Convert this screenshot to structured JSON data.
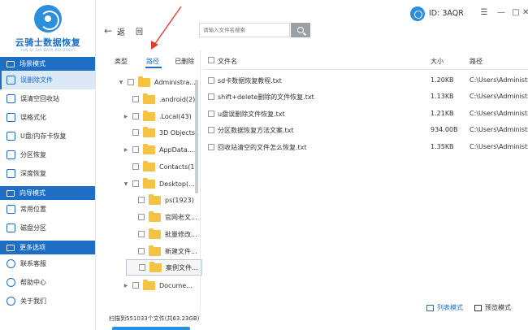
{
  "app": {
    "name": "云骑士数据恢复",
    "subtitle": "YUN QI SHI DATA RECOVERY"
  },
  "account": {
    "id_label": "ID: 3AQR"
  },
  "colors": {
    "accent": "#1e6fc4",
    "folder": "#f5c343",
    "annotation_arrow": "#e53935"
  },
  "sidebar": {
    "sections": [
      {
        "title": "场景模式",
        "items": [
          {
            "label": "误删除文件",
            "icon": "trash-file-icon",
            "active": true
          },
          {
            "label": "误清空回收站",
            "icon": "recycle-bin-icon"
          },
          {
            "label": "误格式化",
            "icon": "format-icon"
          },
          {
            "label": "U盘/内存卡恢复",
            "icon": "usb-icon"
          },
          {
            "label": "分区恢复",
            "icon": "partition-icon"
          },
          {
            "label": "深度恢复",
            "icon": "deep-scan-icon"
          }
        ]
      },
      {
        "title": "向导模式",
        "items": [
          {
            "label": "常用位置",
            "icon": "location-icon"
          },
          {
            "label": "磁盘分区",
            "icon": "disk-icon"
          }
        ]
      },
      {
        "title": "更多选项",
        "items": [
          {
            "label": "联系客服",
            "icon": "support-icon"
          },
          {
            "label": "帮助中心",
            "icon": "help-icon"
          },
          {
            "label": "关于我们",
            "icon": "info-icon"
          }
        ]
      }
    ]
  },
  "toolbar": {
    "back_label": "返",
    "home_label": "回",
    "search_placeholder": "请输入文件名搜索"
  },
  "tree": {
    "tabs": [
      "类型",
      "路径",
      "已删除"
    ],
    "active_tab": 1,
    "nodes": [
      {
        "label": "Administra...",
        "expand": "▼",
        "level": 0
      },
      {
        "label": ".android(2)",
        "expand": "",
        "level": 1
      },
      {
        "label": ".Local(43)",
        "expand": "▶",
        "level": 1
      },
      {
        "label": "3D Objects...",
        "expand": "",
        "level": 1
      },
      {
        "label": "AppData...",
        "expand": "▶",
        "level": 1
      },
      {
        "label": "Contacts(1)",
        "expand": "",
        "level": 1
      },
      {
        "label": "Desktop(...",
        "expand": "▼",
        "level": 1
      },
      {
        "label": "ps(1923)",
        "expand": "",
        "level": 2
      },
      {
        "label": "官网老文...",
        "expand": "",
        "level": 2
      },
      {
        "label": "批量修改...",
        "expand": "",
        "level": 2
      },
      {
        "label": "新建文件...",
        "expand": "",
        "level": 2
      },
      {
        "label": "案例文件...",
        "expand": "",
        "level": 2,
        "selected": true
      },
      {
        "label": "Docume...",
        "expand": "▶",
        "level": 1
      }
    ]
  },
  "file_list": {
    "headers": {
      "name": "文件名",
      "size": "大小",
      "path": "路径"
    },
    "rows": [
      {
        "name": "sd卡数据恢复教程.txt",
        "size": "1.20KB",
        "path": "C:\\Users\\Administr..."
      },
      {
        "name": "shift+delete删除的文件恢复.txt",
        "size": "1.13KB",
        "path": "C:\\Users\\Administr..."
      },
      {
        "name": "u盘误删除文件恢复.txt",
        "size": "1.21KB",
        "path": "C:\\Users\\Administr..."
      },
      {
        "name": "分区数据恢复方法文案.txt",
        "size": "934.00B",
        "path": "C:\\Users\\Administr..."
      },
      {
        "name": "回收站清空的文件怎么恢复.txt",
        "size": "1.35KB",
        "path": "C:\\Users\\Administr..."
      }
    ]
  },
  "status": {
    "scan_text": "扫描到551033个文件(共63.23GB)"
  },
  "view_modes": {
    "list_label": "列表模式",
    "preview_label": "预览模式",
    "active": "list"
  }
}
